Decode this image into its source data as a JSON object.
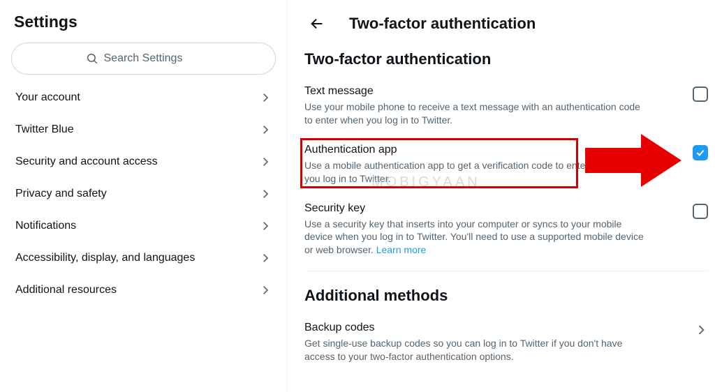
{
  "sidebar": {
    "title": "Settings",
    "search_placeholder": "Search Settings",
    "items": [
      {
        "label": "Your account"
      },
      {
        "label": "Twitter Blue"
      },
      {
        "label": "Security and account access"
      },
      {
        "label": "Privacy and safety"
      },
      {
        "label": "Notifications"
      },
      {
        "label": "Accessibility, display, and languages"
      },
      {
        "label": "Additional resources"
      }
    ]
  },
  "main": {
    "title": "Two-factor authentication",
    "section_title": "Two-factor authentication",
    "options": {
      "text_message": {
        "label": "Text message",
        "desc": "Use your mobile phone to receive a text message with an authentication code to enter when you log in to Twitter."
      },
      "auth_app": {
        "label": "Authentication app",
        "desc": "Use a mobile authentication app to get a verification code to enter every time you log in to Twitter."
      },
      "security_key": {
        "label": "Security key",
        "desc": "Use a security key that inserts into your computer or syncs to your mobile device when you log in to Twitter. You'll need to use a supported mobile device or web browser. ",
        "link": "Learn more"
      }
    },
    "additional_title": "Additional methods",
    "backup": {
      "label": "Backup codes",
      "desc": "Get single-use backup codes so you can log in to Twitter if you don't have access to your two-factor authentication options."
    }
  },
  "watermark": "MOBIGYAAN"
}
